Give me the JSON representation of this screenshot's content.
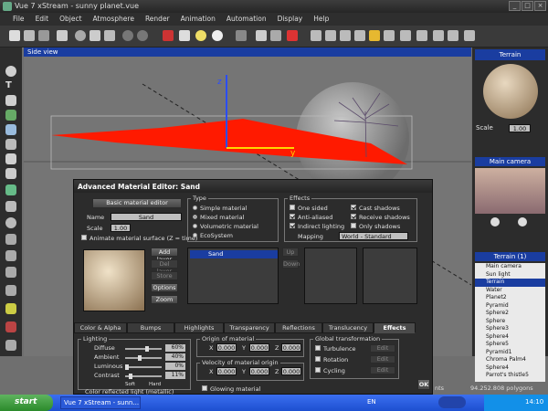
{
  "window": {
    "title": "Vue 7 xStream - sunny planet.vue"
  },
  "menu": [
    "File",
    "Edit",
    "Object",
    "Atmosphere",
    "Render",
    "Animation",
    "Automation",
    "Display",
    "Help"
  ],
  "viewport": {
    "label": "Side view",
    "axis_z": "z",
    "axis_y": "y"
  },
  "right_panel": {
    "material_label": "Terrain",
    "scale_label": "Scale",
    "scale_value": "1.00",
    "camera_label": "Main camera",
    "tree_root": "Terrain (1)",
    "tree_items": [
      "Main camera",
      "Sun light",
      "Terrain",
      "Water",
      "Planet2",
      "Pyramid",
      "Sphere2",
      "Sphere",
      "Sphere3",
      "Sphere4",
      "Sphere5",
      "Pyramid1",
      "Chroma Palm4",
      "Sphere4",
      "Parrot's thistle5"
    ]
  },
  "editor": {
    "title": "Advanced Material Editor: Sand",
    "basic_button": "Basic material editor",
    "name_label": "Name",
    "name_value": "Sand",
    "scale_label": "Scale",
    "scale_value": "1.00",
    "animate_label": "Animate material surface (Z = time)",
    "buttons": {
      "add_layer": "Add layer",
      "del_layer": "Del layer",
      "store": "Store",
      "options": "Options",
      "zoom": "Zoom",
      "up": "Up",
      "down": "Down"
    },
    "layer_name": "Sand",
    "type": {
      "title": "Type",
      "options": [
        "Simple material",
        "Mixed material",
        "Volumetric material",
        "EcoSystem"
      ],
      "selected": "Mixed material"
    },
    "effects": {
      "title": "Effects",
      "left": [
        {
          "label": "One sided",
          "checked": false
        },
        {
          "label": "Anti-aliased",
          "checked": true
        },
        {
          "label": "Indirect lighting",
          "checked": true
        }
      ],
      "right": [
        {
          "label": "Cast shadows",
          "checked": true
        },
        {
          "label": "Receive shadows",
          "checked": true
        },
        {
          "label": "Only shadows",
          "checked": false
        }
      ],
      "mapping_label": "Mapping",
      "mapping_value": "World - Standard"
    },
    "tabs": [
      "Color & Alpha",
      "Bumps",
      "Highlights",
      "Transparency",
      "Reflections",
      "Translucency",
      "Effects"
    ],
    "active_tab": "Effects",
    "lighting": {
      "title": "Lighting",
      "rows": [
        {
          "label": "Diffuse",
          "value": "60%",
          "fraction": 0.6
        },
        {
          "label": "Ambient",
          "value": "40%",
          "fraction": 0.4
        },
        {
          "label": "Luminous",
          "value": "0%",
          "fraction": 0.0
        },
        {
          "label": "Contrast",
          "value": "11%",
          "fraction": 0.11
        }
      ],
      "soft": "Soft",
      "hard": "Hard",
      "reflected": "Color reflected light (metallic)"
    },
    "origin": {
      "title": "Origin of material",
      "x": "0.000",
      "y": "0.000",
      "z": "0.000",
      "velocity_title": "Velocity of material origin",
      "vx": "0.000",
      "vy": "0.000",
      "vz": "0.000",
      "glowing": "Glowing material"
    },
    "global": {
      "title": "Global transformation",
      "items": [
        "Turbulence",
        "Rotation",
        "Cycling"
      ],
      "edit": "Edit"
    },
    "ok": "OK"
  },
  "status": {
    "text1": "nts",
    "text2": "94.252.808 polygons"
  },
  "taskbar": {
    "start": "start",
    "task": "Vue 7 xStream - sunn...",
    "lang": "EN",
    "clock": "14:10"
  },
  "colors": {
    "terrain_red": "#ff1a00",
    "axis_yellow": "#ffd400",
    "axis_blue": "#2a4dff",
    "viewport_bg": "#757575",
    "title_blue": "#1a3da0"
  }
}
